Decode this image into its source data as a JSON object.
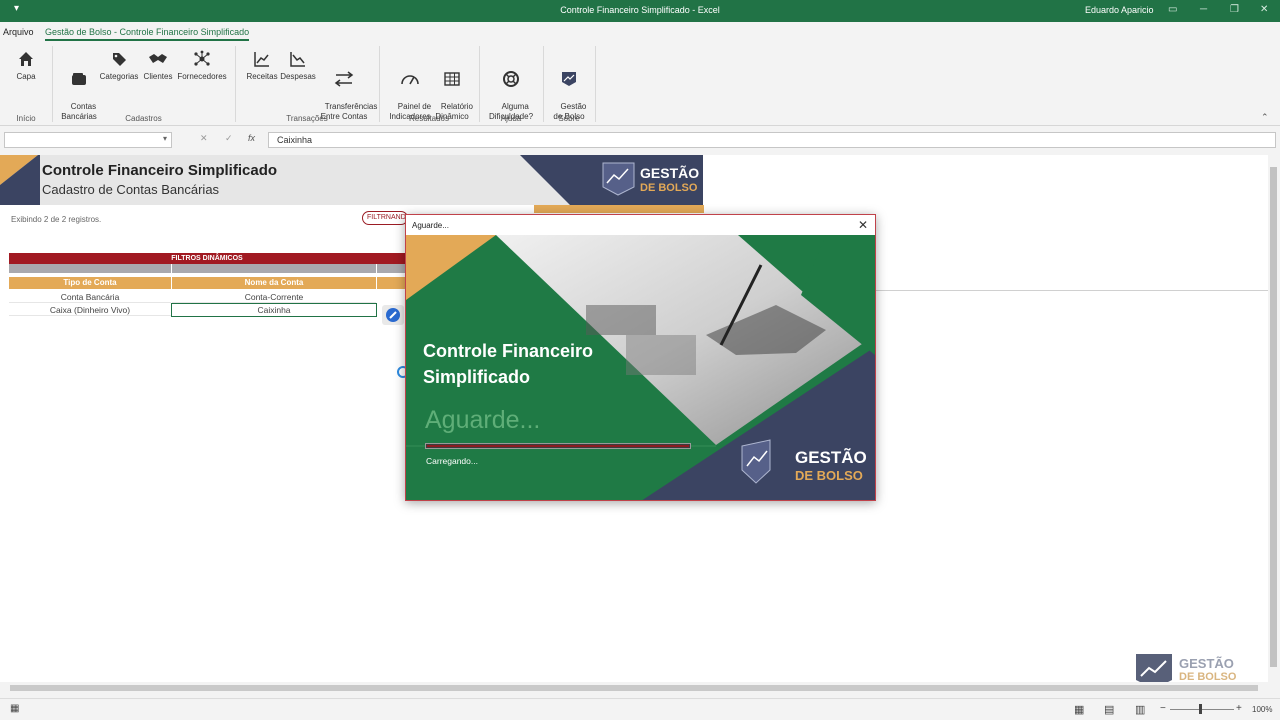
{
  "window": {
    "title": "Controle Financeiro Simplificado  -  Excel",
    "user": "Eduardo Aparicio",
    "qat_icon": "customize-quick-access-icon",
    "controls": [
      "ribbon-display-icon",
      "minimize-icon",
      "restore-icon",
      "close-icon"
    ]
  },
  "menu": {
    "file": "Arquivo",
    "active_tab": "Gestão de Bolso - Controle Financeiro Simplificado"
  },
  "ribbon": {
    "buttons": [
      {
        "label": "Capa",
        "icon": "home-icon"
      },
      {
        "label": "Contas\nBancárias",
        "icon": "wallet-icon"
      },
      {
        "label": "Categorias",
        "icon": "tag-icon"
      },
      {
        "label": "Clientes",
        "icon": "handshake-icon"
      },
      {
        "label": "Fornecedores",
        "icon": "network-icon"
      },
      {
        "label": "Receitas",
        "icon": "line-up-icon"
      },
      {
        "label": "Despesas",
        "icon": "line-down-icon"
      },
      {
        "label": "Transferências\nEntre Contas",
        "icon": "transfer-arrows-icon"
      },
      {
        "label": "Painel de\nIndicadores",
        "icon": "gauge-icon"
      },
      {
        "label": "Relatório\nDinâmico",
        "icon": "table-icon"
      },
      {
        "label": "Alguma\nDificuldade?",
        "icon": "lifebuoy-icon"
      },
      {
        "label": "Gestão\nde Bolso",
        "icon": "pocket-logo-icon"
      }
    ],
    "groups": [
      "Início",
      "Cadastros",
      "Transações",
      "Resultados",
      "Ajuda",
      "Sobre"
    ],
    "collapse_icon": "chevron-up-icon"
  },
  "formula_bar": {
    "name_box": "",
    "cancel_icon": "✕",
    "enter_icon": "✓",
    "fx_label": "fx",
    "value": "Caixinha"
  },
  "sheet": {
    "banner_title": "Controle Financeiro Simplificado",
    "banner_subtitle": "Cadastro de Contas Bancárias",
    "logo_line1": "GESTÃO",
    "logo_line2": "DE BOLSO",
    "records_text": "Exibindo 2 de 2 registros.",
    "filter_pill": "FILTRNANDO",
    "filters_header": "FILTROS DINÂMICOS",
    "columns": [
      "Tipo de Conta",
      "Nome da Conta"
    ],
    "rows": [
      [
        "Conta Bancária",
        "Conta-Corrente"
      ],
      [
        "Caixa (Dinheiro Vivo)",
        "Caixinha"
      ]
    ],
    "edit_icon": "edit-pencil-icon"
  },
  "dialog": {
    "title": "Aguarde...",
    "close_icon": "close-icon",
    "splash_title": "Controle Financeiro Simplificado",
    "splash_wait": "Aguarde...",
    "loading_text": "Carregando...",
    "progress_fraction": 1.0,
    "logo_line1": "GESTÃO",
    "logo_line2": "DE BOLSO"
  },
  "status_bar": {
    "zoom": "100%",
    "views": [
      "normal-view-icon",
      "page-layout-icon",
      "page-break-icon"
    ]
  },
  "colors": {
    "excel_green": "#217346",
    "brand_green": "#1f7a45",
    "brand_navy": "#3b4462",
    "brand_gold": "#e3a957",
    "brand_red": "#a11a22"
  }
}
